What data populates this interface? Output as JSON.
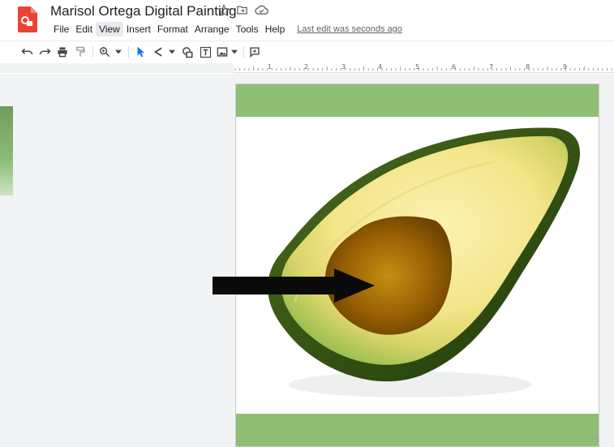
{
  "document": {
    "title": "Marisol Ortega Digital Painting",
    "last_edit": "Last edit was seconds ago"
  },
  "menu": {
    "items": [
      "File",
      "Edit",
      "View",
      "Insert",
      "Format",
      "Arrange",
      "Tools",
      "Help"
    ],
    "active": "View"
  },
  "header_icons": [
    "star-icon",
    "move-to-folder-icon",
    "cloud-status-icon"
  ],
  "toolbar": {
    "tools": [
      "undo-icon",
      "redo-icon",
      "print-icon",
      "paint-format-icon",
      "zoom-icon",
      "select-icon",
      "line-icon",
      "shape-icon",
      "text-box-icon",
      "image-icon",
      "comment-icon"
    ]
  },
  "ruler": {
    "numbers": [
      "1",
      "2",
      "3",
      "4",
      "5",
      "6",
      "7",
      "8",
      "9"
    ]
  },
  "colors": {
    "accent_band": "#8fbe75",
    "app_logo": "#ea4335",
    "canvas_bg": "#f1f3f4"
  }
}
